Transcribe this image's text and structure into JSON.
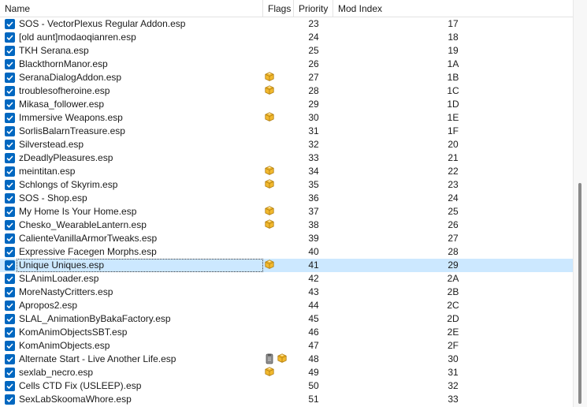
{
  "columns": {
    "name": "Name",
    "flags": "Flags",
    "priority": "Priority",
    "mod_index": "Mod Index"
  },
  "sort_indicator": "^",
  "rows": [
    {
      "name": "SOS - VectorPlexus Regular Addon.esp",
      "flags": [],
      "priority": "23",
      "mod_index": "17",
      "checked": true
    },
    {
      "name": "[old aunt]modaoqianren.esp",
      "flags": [],
      "priority": "24",
      "mod_index": "18",
      "checked": true
    },
    {
      "name": "TKH Serana.esp",
      "flags": [],
      "priority": "25",
      "mod_index": "19",
      "checked": true
    },
    {
      "name": "BlackthornManor.esp",
      "flags": [],
      "priority": "26",
      "mod_index": "1A",
      "checked": true
    },
    {
      "name": "SeranaDialogAddon.esp",
      "flags": [
        "package-icon"
      ],
      "priority": "27",
      "mod_index": "1B",
      "checked": true
    },
    {
      "name": "troublesofheroine.esp",
      "flags": [
        "package-icon"
      ],
      "priority": "28",
      "mod_index": "1C",
      "checked": true
    },
    {
      "name": "Mikasa_follower.esp",
      "flags": [],
      "priority": "29",
      "mod_index": "1D",
      "checked": true
    },
    {
      "name": "Immersive Weapons.esp",
      "flags": [
        "package-icon"
      ],
      "priority": "30",
      "mod_index": "1E",
      "checked": true
    },
    {
      "name": "SorlisBalarnTreasure.esp",
      "flags": [],
      "priority": "31",
      "mod_index": "1F",
      "checked": true
    },
    {
      "name": "Silverstead.esp",
      "flags": [],
      "priority": "32",
      "mod_index": "20",
      "checked": true
    },
    {
      "name": "zDeadlyPleasures.esp",
      "flags": [],
      "priority": "33",
      "mod_index": "21",
      "checked": true
    },
    {
      "name": "meintitan.esp",
      "flags": [
        "package-icon"
      ],
      "priority": "34",
      "mod_index": "22",
      "checked": true
    },
    {
      "name": "Schlongs of Skyrim.esp",
      "flags": [
        "package-icon"
      ],
      "priority": "35",
      "mod_index": "23",
      "checked": true
    },
    {
      "name": "SOS - Shop.esp",
      "flags": [],
      "priority": "36",
      "mod_index": "24",
      "checked": true
    },
    {
      "name": "My Home Is Your Home.esp",
      "flags": [
        "package-icon"
      ],
      "priority": "37",
      "mod_index": "25",
      "checked": true
    },
    {
      "name": "Chesko_WearableLantern.esp",
      "flags": [
        "package-icon"
      ],
      "priority": "38",
      "mod_index": "26",
      "checked": true
    },
    {
      "name": "CalienteVanillaArmorTweaks.esp",
      "flags": [],
      "priority": "39",
      "mod_index": "27",
      "checked": true
    },
    {
      "name": "Expressive Facegen Morphs.esp",
      "flags": [],
      "priority": "40",
      "mod_index": "28",
      "checked": true
    },
    {
      "name": "Unique Uniques.esp",
      "flags": [
        "package-icon"
      ],
      "priority": "41",
      "mod_index": "29",
      "checked": true,
      "selected": true
    },
    {
      "name": "SLAnimLoader.esp",
      "flags": [],
      "priority": "42",
      "mod_index": "2A",
      "checked": true
    },
    {
      "name": "MoreNastyCritters.esp",
      "flags": [],
      "priority": "43",
      "mod_index": "2B",
      "checked": true
    },
    {
      "name": "Apropos2.esp",
      "flags": [],
      "priority": "44",
      "mod_index": "2C",
      "checked": true
    },
    {
      "name": "SLAL_AnimationByBakaFactory.esp",
      "flags": [],
      "priority": "45",
      "mod_index": "2D",
      "checked": true
    },
    {
      "name": "KomAnimObjectsSBT.esp",
      "flags": [],
      "priority": "46",
      "mod_index": "2E",
      "checked": true
    },
    {
      "name": "KomAnimObjects.esp",
      "flags": [],
      "priority": "47",
      "mod_index": "2F",
      "checked": true
    },
    {
      "name": "Alternate Start - Live Another Life.esp",
      "flags": [
        "clip-icon",
        "package-icon"
      ],
      "priority": "48",
      "mod_index": "30",
      "checked": true
    },
    {
      "name": "sexlab_necro.esp",
      "flags": [
        "package-icon"
      ],
      "priority": "49",
      "mod_index": "31",
      "checked": true
    },
    {
      "name": "Cells CTD Fix (USLEEP).esp",
      "flags": [],
      "priority": "50",
      "mod_index": "32",
      "checked": true
    },
    {
      "name": "SexLabSkoomaWhore.esp",
      "flags": [],
      "priority": "51",
      "mod_index": "33",
      "checked": true
    }
  ],
  "scrollbar": {
    "position_fraction": 0.55
  }
}
